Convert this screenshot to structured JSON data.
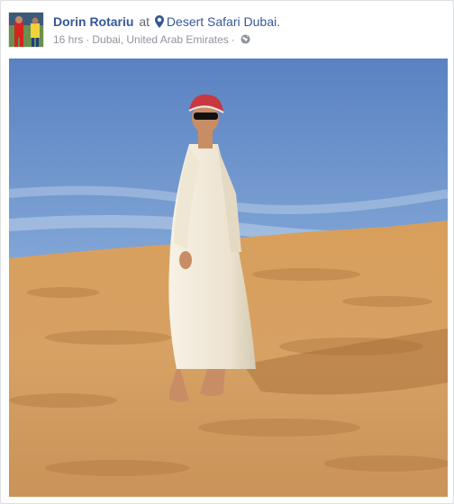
{
  "post": {
    "author": "Dorin Rotariu",
    "at_word": "at",
    "place": "Desert Safari Dubai.",
    "time": "16 hrs",
    "separator": "·",
    "location": "Dubai, United Arab Emirates",
    "audience_icon": "globe-icon",
    "place_icon": "location-pin-icon"
  },
  "colors": {
    "link": "#365899",
    "meta": "#90949c",
    "sky_top": "#5f86c4",
    "sand": "#d9a25f"
  }
}
